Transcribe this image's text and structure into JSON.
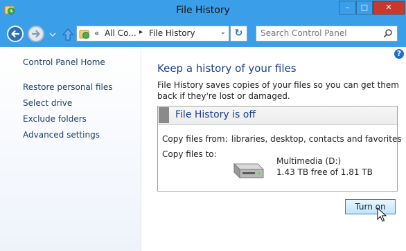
{
  "window": {
    "title": "File History",
    "minimize_glyph": "–",
    "maximize_glyph": "□",
    "close_glyph": "✕"
  },
  "nav": {
    "address": {
      "overflow": "«",
      "crumb_parent": "All Co...",
      "separator": "▸",
      "crumb_current": "File History",
      "dropdown_glyph": "⌄"
    },
    "refresh_glyph": "↻",
    "search_placeholder": "Search Control Panel"
  },
  "sidebar": {
    "home": "Control Panel Home",
    "links": [
      "Restore personal files",
      "Select drive",
      "Exclude folders",
      "Advanced settings"
    ]
  },
  "main": {
    "help_glyph": "?",
    "heading": "Keep a history of your files",
    "description": "File History saves copies of your files so you can get them back if they're lost or damaged.",
    "panel": {
      "title": "File History is off",
      "copy_from_label": "Copy files from:",
      "copy_from_value": "libraries, desktop, contacts and favorites",
      "copy_to_label": "Copy files to:",
      "drive_name": "Multimedia (D:)",
      "drive_free": "1.43 TB free of 1.81 TB"
    },
    "turn_on_label": "Turn on"
  },
  "colors": {
    "titlebar": "#3a9ee8",
    "close_button": "#c7392b",
    "heading": "#1a3e8c",
    "link": "#1e3d6b"
  },
  "icons": [
    "file-history-icon",
    "back-arrow-icon",
    "forward-arrow-icon",
    "chevron-down-icon",
    "up-arrow-icon",
    "refresh-icon",
    "search-icon",
    "help-icon",
    "hard-drive-icon",
    "mouse-cursor-icon"
  ]
}
